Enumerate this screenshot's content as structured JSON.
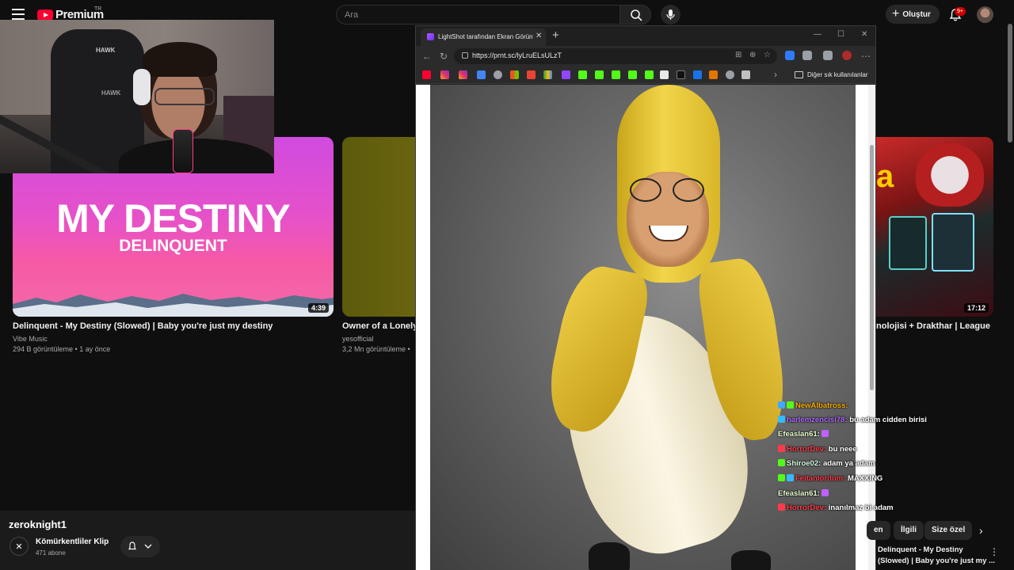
{
  "youtube": {
    "logo_text": "Premium",
    "region": "TR",
    "search_placeholder": "Ara",
    "create_label": "Oluştur",
    "notification_count": "9+"
  },
  "cam": {
    "chair_logo_top": "HAWK",
    "chair_logo_bottom": "HAWK"
  },
  "videos": [
    {
      "thumb_title": "MY DESTINY",
      "thumb_sub": "DELINQUENT",
      "duration": "4:39",
      "title": "Delinquent - My Destiny (Slowed) | Baby you're just my destiny",
      "channel": "Vibe Music",
      "meta": "294 B görüntüleme • 1 ay önce"
    },
    {
      "title": "Owner of a Lonely",
      "channel": "yesofficial",
      "meta": "3,2 Mn görüntüleme •"
    },
    {
      "duration": "17:12",
      "thumb_letter": "a",
      "title": "nolojisi + Drakthar | League"
    }
  ],
  "channel_panel": {
    "title": "zeroknight1",
    "channel_name": "Kömürkentliler Klip",
    "subscribers": "471 abone"
  },
  "browser": {
    "tab_title": "LightShot tarafından Ekran Görüntüsü",
    "url": "https://prnt.sc/lyLruELsULzT",
    "bookmarks_other": "Diğer sık kullanılanlar"
  },
  "chat": [
    {
      "user": "NewAlbatross:",
      "msg": "",
      "color": "#ffb300",
      "icon": "#3fa9ff"
    },
    {
      "user": "harlemzencisi78:",
      "msg": "bu adam cidden birisi",
      "color": "#b06bff",
      "icon": "#33bbff"
    },
    {
      "user": "Efeaslan61:",
      "msg": "",
      "color": "#e8ffd0",
      "icon": "#c060ff"
    },
    {
      "user": "HorrorDev:",
      "msg": "bu neee",
      "color": "#ff3a4a",
      "icon": "#ff3a4a"
    },
    {
      "user": "Shiroe02:",
      "msg": "adam ya adam",
      "color": "#d9ffe0",
      "icon": "#53fc18"
    },
    {
      "user": "Feitanlordum:",
      "msg": "MAXXING",
      "color": "#ff3a4a",
      "icon": "#53fc18"
    },
    {
      "user": "Efeaslan61:",
      "msg": "",
      "color": "#e8ffd0",
      "icon": "#c060ff"
    },
    {
      "user": "HorrorDev:",
      "msg": "inanılmaz bi adam",
      "color": "#ff3a4a",
      "icon": "#ff3a4a"
    }
  ],
  "chips": [
    "en",
    "İlgili",
    "Size özel"
  ],
  "related": {
    "line1": "Delinquent - My Destiny",
    "line2": "(Slowed) | Baby you're just my ..."
  }
}
